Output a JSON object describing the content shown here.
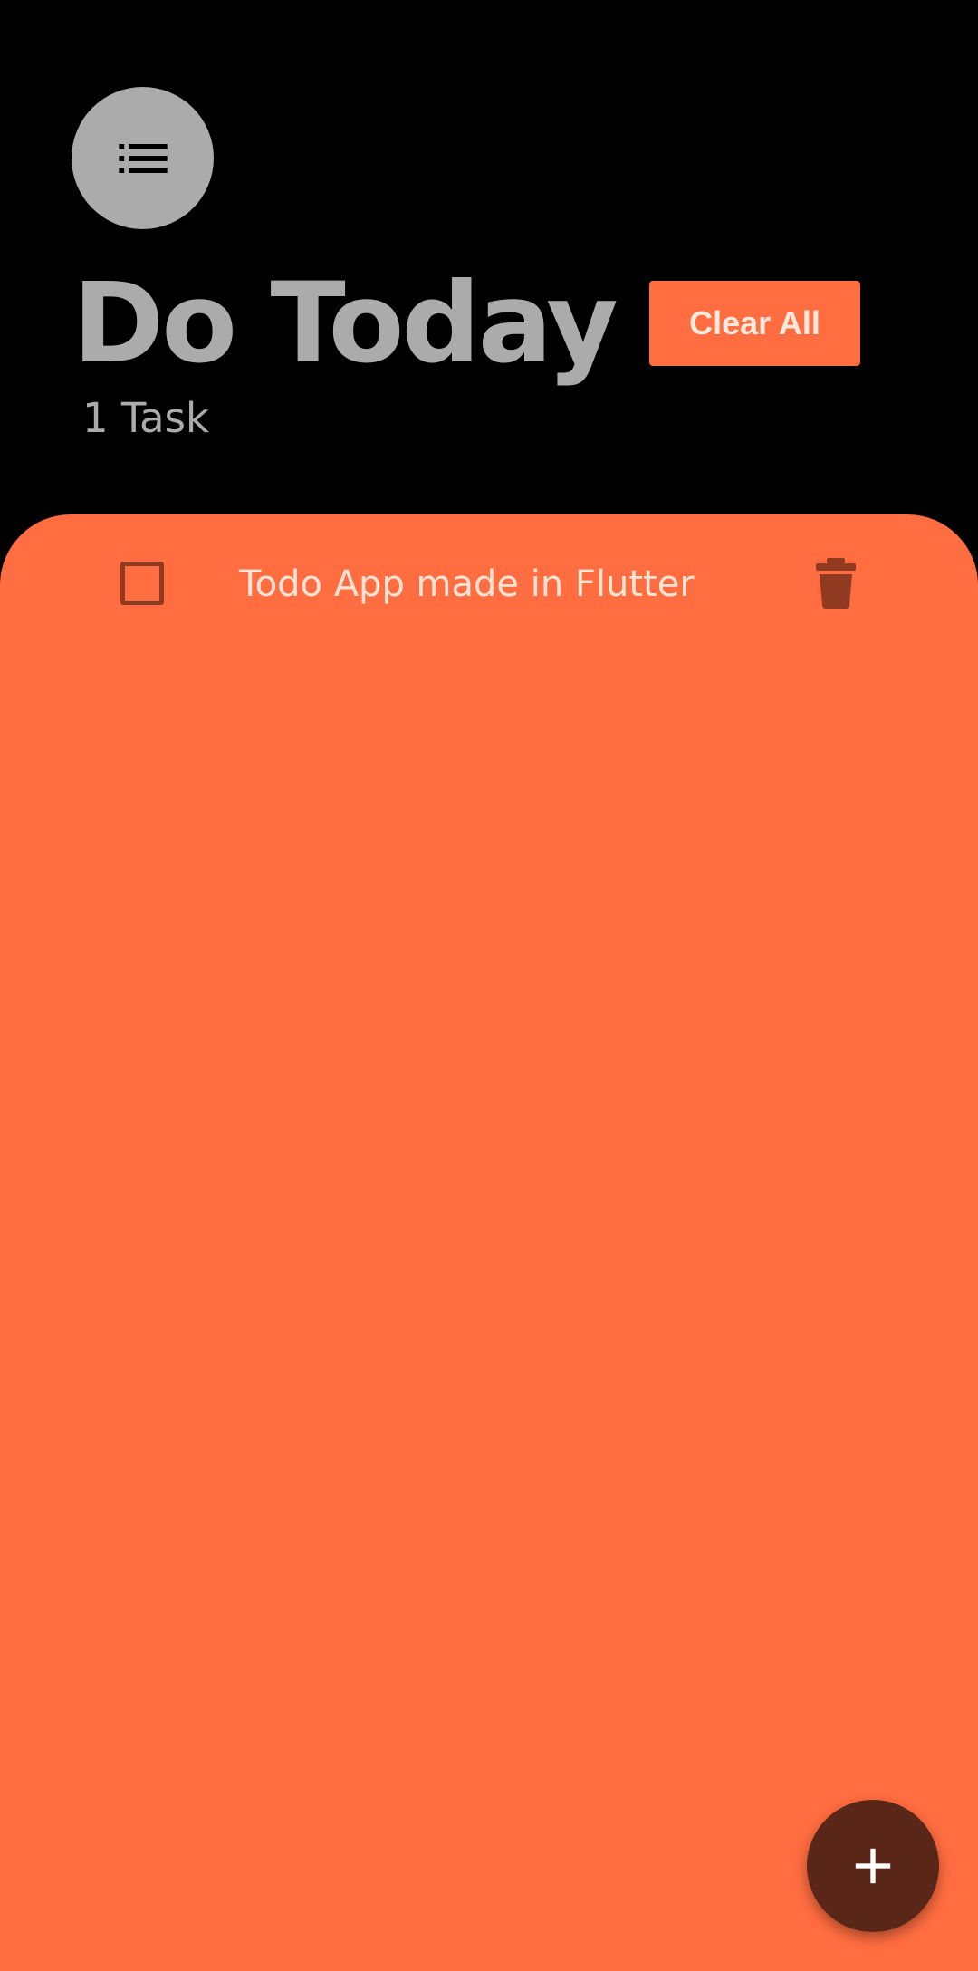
{
  "header": {
    "menu_icon": "list-icon",
    "title": "Do Today",
    "task_count": "1 Task",
    "clear_all_label": "Clear All"
  },
  "tasks": [
    {
      "text": "Todo App made in Flutter",
      "checked": false,
      "checkbox_icon": "checkbox-outline-icon",
      "delete_icon": "trash-icon"
    }
  ],
  "fab": {
    "icon": "plus-icon"
  },
  "colors": {
    "background": "#000000",
    "accent": "#ff6d40",
    "muted_gray": "#ababab",
    "dark_accent": "#8f3a21",
    "fab": "#5a2617"
  }
}
